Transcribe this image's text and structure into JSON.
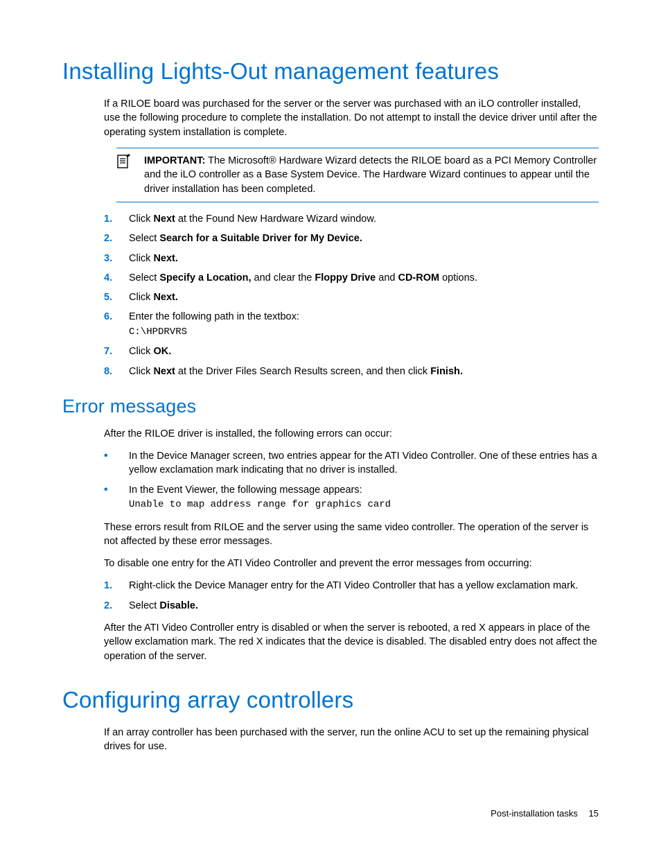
{
  "h1_install": "Installing Lights-Out management features",
  "intro_install": "If a RILOE board was purchased for the server or the server was purchased with an iLO controller installed, use the following procedure to complete the installation. Do not attempt to install the device driver until after the operating system installation is complete.",
  "important": {
    "label": "IMPORTANT:",
    "text": "  The Microsoft® Hardware Wizard detects the RILOE board as a PCI Memory Controller and the iLO controller as a Base System Device. The Hardware Wizard continues to appear until the driver installation has been completed."
  },
  "steps_install": [
    {
      "n": "1.",
      "pre": "Click ",
      "b": "Next",
      "post": " at the Found New Hardware Wizard window."
    },
    {
      "n": "2.",
      "pre": "Select ",
      "b": "Search for a Suitable Driver for My Device.",
      "post": ""
    },
    {
      "n": "3.",
      "pre": "Click ",
      "b": "Next.",
      "post": ""
    },
    {
      "n": "4.",
      "pre": "Select ",
      "b": "Specify a Location,",
      "mid": " and clear the ",
      "b2": "Floppy Drive",
      "mid2": " and ",
      "b3": "CD-ROM",
      "post": " options."
    },
    {
      "n": "5.",
      "pre": "Click ",
      "b": "Next.",
      "post": ""
    },
    {
      "n": "6.",
      "pre": "Enter the following path in the textbox:",
      "code": "C:\\HPDRVRS"
    },
    {
      "n": "7.",
      "pre": "Click ",
      "b": "OK.",
      "post": ""
    },
    {
      "n": "8.",
      "pre": "Click ",
      "b": "Next",
      "mid": " at the Driver Files Search Results screen, and then click ",
      "b2": "Finish.",
      "post": ""
    }
  ],
  "h2_error": "Error messages",
  "error_intro": "After the RILOE driver is installed, the following errors can occur:",
  "error_bullets": [
    {
      "text": "In the Device Manager screen, two entries appear for the ATI Video Controller. One of these entries has a yellow exclamation mark indicating that no driver is installed."
    },
    {
      "text": "In the Event Viewer, the following message appears:",
      "code": "Unable to map address range for graphics card"
    }
  ],
  "error_p1": "These errors result from RILOE and the server using the same video controller. The operation of the server is not affected by these error messages.",
  "error_p2": "To disable one entry for the ATI Video Controller and prevent the error messages from occurring:",
  "steps_disable": [
    {
      "n": "1.",
      "pre": "Right-click the Device Manager entry for the ATI Video Controller that has a yellow exclamation mark."
    },
    {
      "n": "2.",
      "pre": "Select ",
      "b": "Disable.",
      "post": ""
    }
  ],
  "error_p3": "After the ATI Video Controller entry is disabled or when the server is rebooted, a red X appears in place of the yellow exclamation mark. The red X indicates that the device is disabled. The disabled entry does not affect the operation of the server.",
  "h1_config": "Configuring array controllers",
  "config_p": "If an array controller has been purchased with the server, run the online ACU to set up the remaining physical drives for use.",
  "footer_text": "Post-installation tasks",
  "footer_page": "15"
}
